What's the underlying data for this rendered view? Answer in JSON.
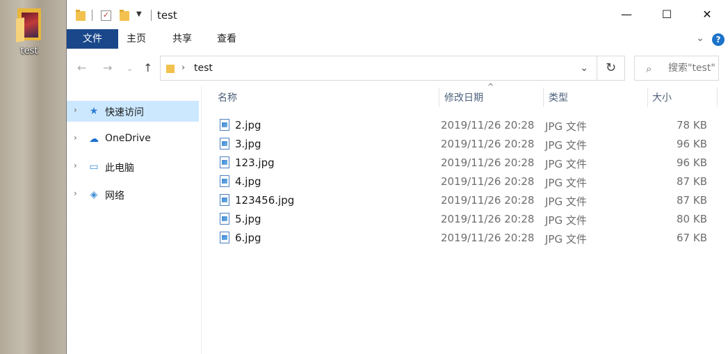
{
  "desktop": {
    "icon_label": "test"
  },
  "window": {
    "title": "test",
    "controls": {
      "minimize": "—",
      "maximize": "☐",
      "close": "✕"
    }
  },
  "ribbon": {
    "tabs": [
      "文件",
      "主页",
      "共享",
      "查看"
    ],
    "help": "?"
  },
  "address": {
    "path": "test",
    "search_placeholder": "搜索\"test\""
  },
  "nav_pane": {
    "items": [
      {
        "label": "快速访问",
        "icon": "star-icon",
        "selected": true
      },
      {
        "label": "OneDrive",
        "icon": "cloud-icon",
        "selected": false
      },
      {
        "label": "此电脑",
        "icon": "computer-icon",
        "selected": false
      },
      {
        "label": "网络",
        "icon": "network-icon",
        "selected": false
      }
    ]
  },
  "columns": {
    "name": "名称",
    "date": "修改日期",
    "type": "类型",
    "size": "大小"
  },
  "files": [
    {
      "name": "2.jpg",
      "date": "2019/11/26 20:28",
      "type": "JPG 文件",
      "size": "78 KB"
    },
    {
      "name": "3.jpg",
      "date": "2019/11/26 20:28",
      "type": "JPG 文件",
      "size": "96 KB"
    },
    {
      "name": "123.jpg",
      "date": "2019/11/26 20:28",
      "type": "JPG 文件",
      "size": "96 KB"
    },
    {
      "name": "4.jpg",
      "date": "2019/11/26 20:28",
      "type": "JPG 文件",
      "size": "87 KB"
    },
    {
      "name": "123456.jpg",
      "date": "2019/11/26 20:28",
      "type": "JPG 文件",
      "size": "87 KB"
    },
    {
      "name": "5.jpg",
      "date": "2019/11/26 20:28",
      "type": "JPG 文件",
      "size": "80 KB"
    },
    {
      "name": "6.jpg",
      "date": "2019/11/26 20:28",
      "type": "JPG 文件",
      "size": "67 KB"
    }
  ],
  "colors": {
    "accent": "#19478a",
    "selection": "#cce8ff",
    "header_text": "#4c607a"
  }
}
